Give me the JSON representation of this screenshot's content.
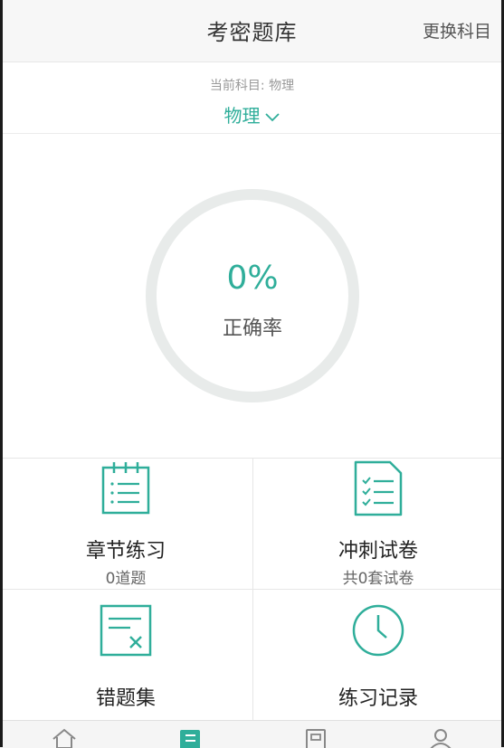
{
  "header": {
    "title": "考密题库",
    "switch_label": "更换科目"
  },
  "subject": {
    "current_label": "当前科目: 物理",
    "selected": "物理"
  },
  "accuracy": {
    "value": "0%",
    "label": "正确率",
    "fraction": 0
  },
  "menu": [
    {
      "label": "章节练习",
      "sub": "0道题",
      "icon": "checklist-icon"
    },
    {
      "label": "冲刺试卷",
      "sub": "共0套试卷",
      "icon": "test-paper-icon"
    },
    {
      "label": "错题集",
      "sub": "",
      "icon": "wrong-questions-icon"
    },
    {
      "label": "练习记录",
      "sub": "",
      "icon": "clock-icon"
    }
  ],
  "tabs": [
    {
      "icon": "home-icon"
    },
    {
      "icon": "question-bank-icon"
    },
    {
      "icon": "exam-icon"
    },
    {
      "icon": "profile-icon"
    }
  ],
  "colors": {
    "accent": "#2fae9a",
    "ring_track": "#e8ebea"
  }
}
